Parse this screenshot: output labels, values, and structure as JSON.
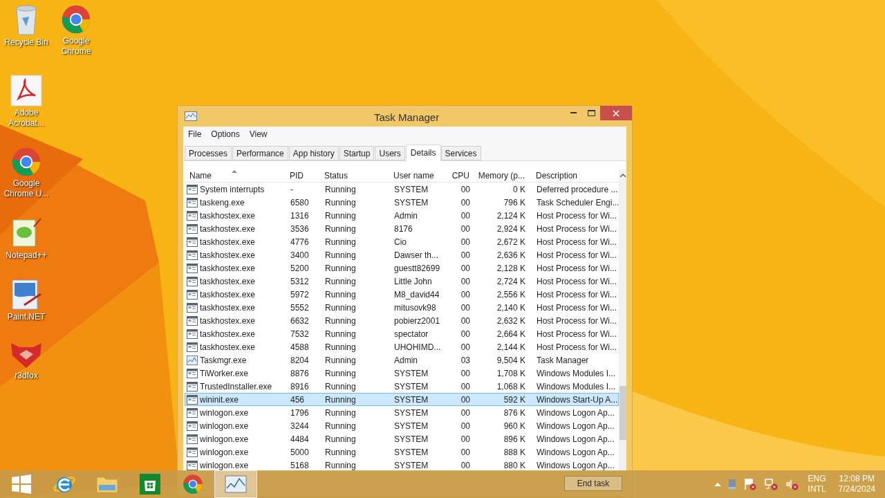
{
  "desktop_icons": [
    {
      "label": "Recycle Bin",
      "kind": "bin"
    },
    {
      "label": "Google Chrome",
      "kind": "chrome"
    },
    {
      "label": "Adobe Acrobat...",
      "kind": "pdf"
    },
    {
      "label": "Google Chrome U...",
      "kind": "chrome"
    },
    {
      "label": "Notepad++",
      "kind": "notepad"
    },
    {
      "label": "Paint.NET",
      "kind": "paint"
    },
    {
      "label": "r3dfox",
      "kind": "fox"
    }
  ],
  "window": {
    "title": "Task Manager"
  },
  "menu": [
    "File",
    "Options",
    "View"
  ],
  "tabs": [
    {
      "label": "Processes",
      "selected": false
    },
    {
      "label": "Performance",
      "selected": false
    },
    {
      "label": "App history",
      "selected": false
    },
    {
      "label": "Startup",
      "selected": false
    },
    {
      "label": "Users",
      "selected": false
    },
    {
      "label": "Details",
      "selected": true
    },
    {
      "label": "Services",
      "selected": false
    }
  ],
  "table": {
    "columns": [
      "Name",
      "PID",
      "Status",
      "User name",
      "CPU",
      "Memory (p...",
      "Description"
    ],
    "rows": [
      {
        "kind": "app",
        "cells": [
          "System interrupts",
          "-",
          "Running",
          "SYSTEM",
          "00",
          "0 K",
          "Deferred procedure ..."
        ],
        "selected": false
      },
      {
        "kind": "app",
        "cells": [
          "taskeng.exe",
          "6580",
          "Running",
          "SYSTEM",
          "00",
          "796 K",
          "Task Scheduler Engi..."
        ],
        "selected": false
      },
      {
        "kind": "app",
        "cells": [
          "taskhostex.exe",
          "1316",
          "Running",
          "Admin",
          "00",
          "2,124 K",
          "Host Process for Wi..."
        ],
        "selected": false
      },
      {
        "kind": "app",
        "cells": [
          "taskhostex.exe",
          "3536",
          "Running",
          "8176",
          "00",
          "2,924 K",
          "Host Process for Wi..."
        ],
        "selected": false
      },
      {
        "kind": "app",
        "cells": [
          "taskhostex.exe",
          "4776",
          "Running",
          "Cio",
          "00",
          "2,672 K",
          "Host Process for Wi..."
        ],
        "selected": false
      },
      {
        "kind": "app",
        "cells": [
          "taskhostex.exe",
          "3400",
          "Running",
          "Dawser th...",
          "00",
          "2,636 K",
          "Host Process for Wi..."
        ],
        "selected": false
      },
      {
        "kind": "app",
        "cells": [
          "taskhostex.exe",
          "5200",
          "Running",
          "guestt82699",
          "00",
          "2,128 K",
          "Host Process for Wi..."
        ],
        "selected": false
      },
      {
        "kind": "app",
        "cells": [
          "taskhostex.exe",
          "5312",
          "Running",
          "Little John",
          "00",
          "2,724 K",
          "Host Process for Wi..."
        ],
        "selected": false
      },
      {
        "kind": "app",
        "cells": [
          "taskhostex.exe",
          "5972",
          "Running",
          "M8_david44",
          "00",
          "2,556 K",
          "Host Process for Wi..."
        ],
        "selected": false
      },
      {
        "kind": "app",
        "cells": [
          "taskhostex.exe",
          "5552",
          "Running",
          "mitusovk98",
          "00",
          "2,140 K",
          "Host Process for Wi..."
        ],
        "selected": false
      },
      {
        "kind": "app",
        "cells": [
          "taskhostex.exe",
          "6632",
          "Running",
          "pobierz2001",
          "00",
          "2,632 K",
          "Host Process for Wi..."
        ],
        "selected": false
      },
      {
        "kind": "app",
        "cells": [
          "taskhostex.exe",
          "7532",
          "Running",
          "spectator",
          "00",
          "2,664 K",
          "Host Process for Wi..."
        ],
        "selected": false
      },
      {
        "kind": "app",
        "cells": [
          "taskhostex.exe",
          "4588",
          "Running",
          "UHOHIMD...",
          "00",
          "2,144 K",
          "Host Process for Wi..."
        ],
        "selected": false
      },
      {
        "kind": "taskmgr",
        "cells": [
          "Taskmgr.exe",
          "8204",
          "Running",
          "Admin",
          "03",
          "9,504 K",
          "Task Manager"
        ],
        "selected": false
      },
      {
        "kind": "app",
        "cells": [
          "TiWorker.exe",
          "8876",
          "Running",
          "SYSTEM",
          "00",
          "1,708 K",
          "Windows Modules I..."
        ],
        "selected": false
      },
      {
        "kind": "app",
        "cells": [
          "TrustedInstaller.exe",
          "8916",
          "Running",
          "SYSTEM",
          "00",
          "1,068 K",
          "Windows Modules I..."
        ],
        "selected": false
      },
      {
        "kind": "app",
        "cells": [
          "wininit.exe",
          "456",
          "Running",
          "SYSTEM",
          "00",
          "592 K",
          "Windows Start-Up A..."
        ],
        "selected": true
      },
      {
        "kind": "app",
        "cells": [
          "winlogon.exe",
          "1796",
          "Running",
          "SYSTEM",
          "00",
          "876 K",
          "Windows Logon Ap..."
        ],
        "selected": false
      },
      {
        "kind": "app",
        "cells": [
          "winlogon.exe",
          "3244",
          "Running",
          "SYSTEM",
          "00",
          "960 K",
          "Windows Logon Ap..."
        ],
        "selected": false
      },
      {
        "kind": "app",
        "cells": [
          "winlogon.exe",
          "4484",
          "Running",
          "SYSTEM",
          "00",
          "896 K",
          "Windows Logon Ap..."
        ],
        "selected": false
      },
      {
        "kind": "app",
        "cells": [
          "winlogon.exe",
          "5000",
          "Running",
          "SYSTEM",
          "00",
          "888 K",
          "Windows Logon Ap..."
        ],
        "selected": false
      },
      {
        "kind": "app",
        "cells": [
          "winlogon.exe",
          "5168",
          "Running",
          "SYSTEM",
          "00",
          "880 K",
          "Windows Logon Ap..."
        ],
        "selected": false
      }
    ]
  },
  "footer": {
    "button": "End task"
  },
  "taskbar": {
    "apps": [
      {
        "kind": "start",
        "active": false
      },
      {
        "kind": "ie",
        "active": false
      },
      {
        "kind": "explorer",
        "active": false
      },
      {
        "kind": "store",
        "active": false
      },
      {
        "kind": "chrome",
        "active": false
      },
      {
        "kind": "taskmgr",
        "active": true
      }
    ],
    "tray": {
      "language": "ENG",
      "layout": "INTL",
      "time": "12:08 PM",
      "date": "7/24/2024"
    }
  }
}
